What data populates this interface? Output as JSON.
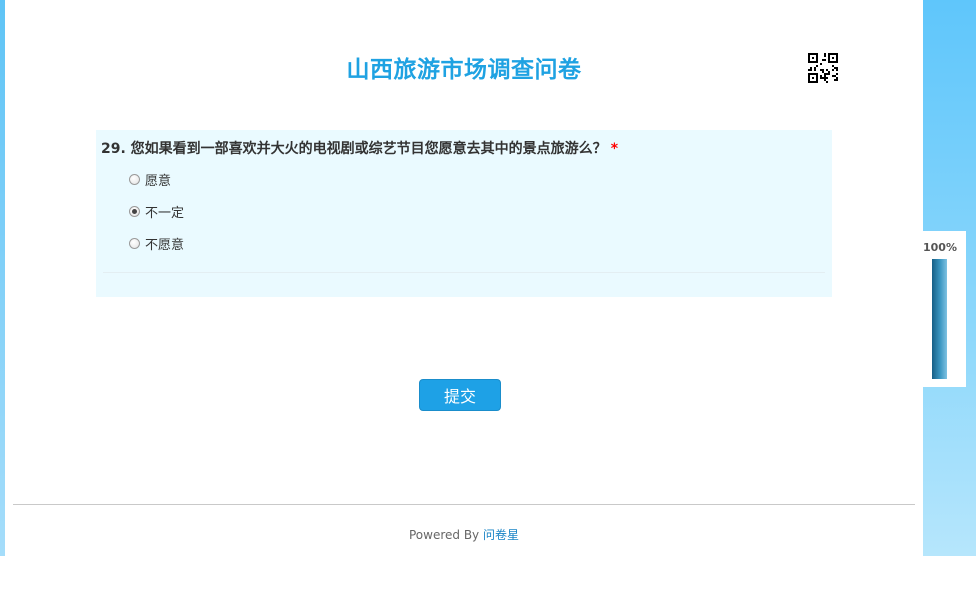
{
  "survey": {
    "title": "山西旅游市场调查问卷"
  },
  "question": {
    "title": "29. 您如果看到一部喜欢并大火的电视剧或综艺节目您愿意去其中的景点旅游么？",
    "required_mark": "*",
    "options": [
      {
        "label": "愿意",
        "checked": false
      },
      {
        "label": "不一定",
        "checked": true
      },
      {
        "label": "不愿意",
        "checked": false
      }
    ]
  },
  "submit": {
    "label": "提交"
  },
  "footer": {
    "powered_by": "Powered By",
    "brand": "问卷星"
  },
  "progress": {
    "label": "100%",
    "value": 1.0
  },
  "colors": {
    "accent": "#1fa2e2",
    "button": "#1ea1e6",
    "question_bg": "#eafaff",
    "required": "#ff0000"
  }
}
